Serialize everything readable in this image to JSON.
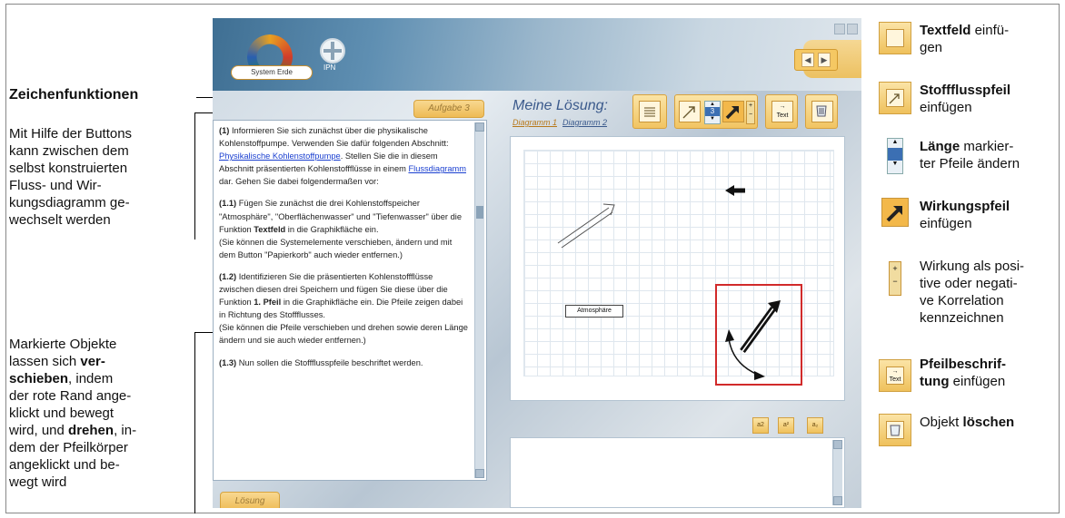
{
  "annotations": {
    "heading": "Zeichenfunktionen",
    "buttons_lines": [
      "Mit Hilfe der Buttons",
      "kann zwischen dem",
      "selbst konstruierten",
      "Fluss- und Wir-",
      "kungsdiagramm ge-",
      "wechselt werden"
    ],
    "marked": {
      "line1": "Markierte Objekte",
      "line2_a": "lassen sich ",
      "line2_b": "ver-",
      "line3_a": "schieben",
      "line3_b": ", indem",
      "line4": "der rote Rand ange-",
      "line5": "klickt und bewegt",
      "line6_a": "wird, und ",
      "line6_b": "drehen",
      "line6_c": ", in-",
      "line7": "dem der Pfeilkörper",
      "line8": "angeklickt und be-",
      "line9": "wegt wird"
    }
  },
  "app": {
    "logo_label": "System Erde",
    "ipn_label": "IPN",
    "task_button": "Aufgabe 3",
    "solution_button": "Lösung",
    "solution_title": "Meine Lösung:",
    "diagram_tabs": [
      "Diagramm 1",
      "Diagramm 2"
    ],
    "tool_text_label": "Text",
    "arrow_length_value": "3",
    "canvas_box_label": "Atmosphäre",
    "sub_buttons": [
      "a2",
      "a²",
      "a₂"
    ],
    "nav_prev": "◀",
    "nav_next": "▶",
    "task_text": {
      "p1_num": "(1)",
      "p1_a": " Informieren Sie sich zunächst über die physikalische Kohlenstoffpumpe. Verwenden Sie dafür folgenden Abschnitt: ",
      "p1_link1": "Physikalische Kohlenstoffpumpe",
      "p1_b": ". Stellen Sie die in diesem Abschnitt präsentierten Kohlenstoffflüsse in einem ",
      "p1_link2": "Flussdiagramm",
      "p1_c": " dar. Gehen Sie dabei folgendermaßen vor:",
      "p2_num": "(1.1)",
      "p2_a": " Fügen Sie zunächst die drei Kohlenstoffspeicher \"Atmosphäre\", \"Oberflächenwasser\" und \"Tiefenwasser\" über die Funktion ",
      "p2_bold": "Textfeld",
      "p2_b": " in die Graphikfläche ein.",
      "p2_c": "(Sie können die Systemelemente verschieben, ändern und mit dem Button \"Papierkorb\" auch wieder entfernen.)",
      "p3_num": "(1.2)",
      "p3_a": " Identifizieren Sie die präsentierten Kohlenstoffflüsse zwischen diesen drei Speichern und fügen Sie diese über die Funktion ",
      "p3_bold": "1. Pfeil",
      "p3_b": " in die Graphikfläche ein. Die Pfeile zeigen dabei in Richtung des Stoffflusses.",
      "p3_c": "(Sie können die Pfeile verschieben und drehen sowie deren Länge ändern und sie auch wieder entfernen.)",
      "p4_num": "(1.3)",
      "p4_a": " Nun sollen die Stoffflusspfeile beschriftet werden."
    }
  },
  "legend": {
    "textfeld_bold": "Textfeld",
    "textfeld_rest1": " einfü-",
    "textfeld_rest2": "gen",
    "stofffluss_bold": "Stoffflusspfeil",
    "stofffluss_rest": "einfügen",
    "laenge_bold": "Länge",
    "laenge_rest1": " markier-",
    "laenge_rest2": "ter Pfeile ändern",
    "wirkung_bold": "Wirkungspfeil",
    "wirkung_rest": "einfügen",
    "korrelation_lines": [
      "Wirkung als posi-",
      "tive oder negati-",
      "ve Korrelation",
      "kennzeichnen"
    ],
    "beschrift_bold1": "Pfeilbeschrif-",
    "beschrift_bold2": "tung",
    "beschrift_rest": " einfügen",
    "loeschen_a": "Objekt ",
    "loeschen_bold": "löschen"
  }
}
